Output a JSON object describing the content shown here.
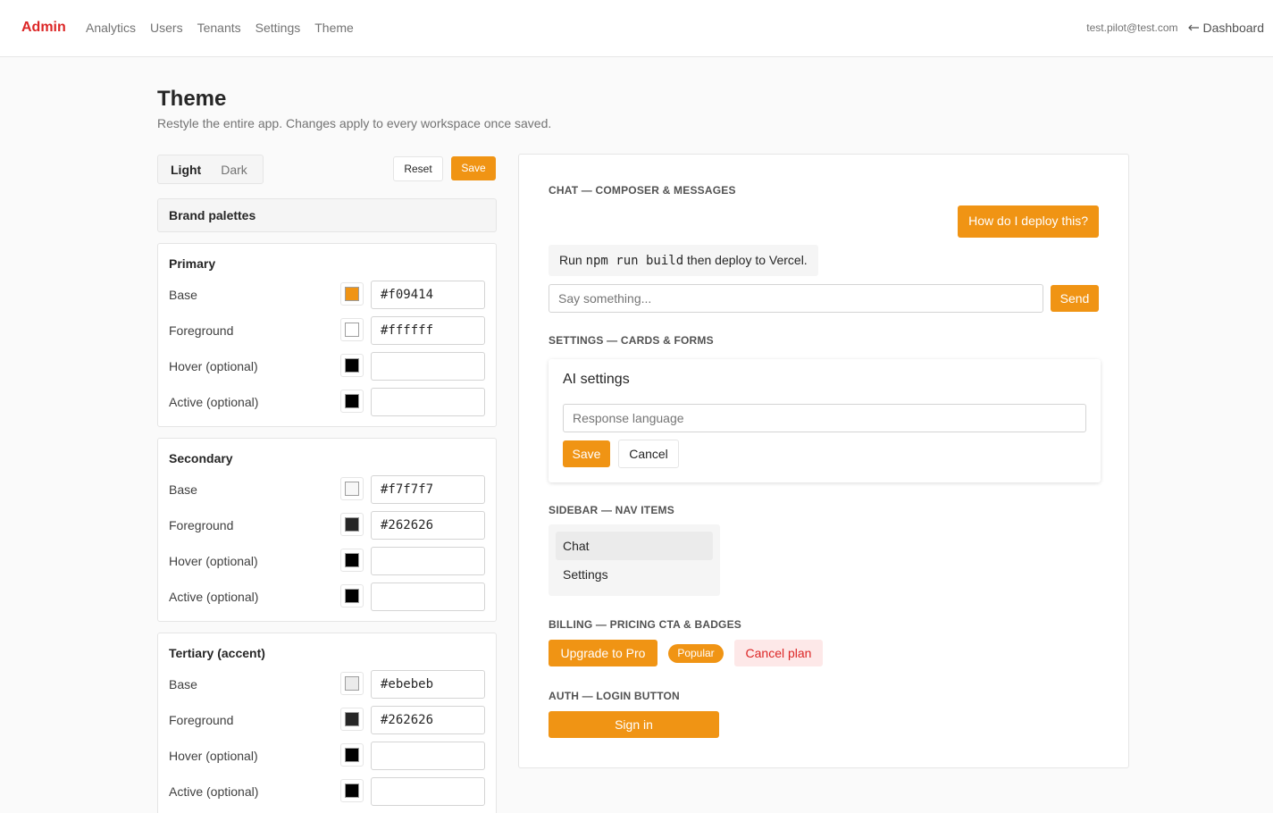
{
  "nav": {
    "brand": "Admin",
    "links": [
      "Analytics",
      "Users",
      "Tenants",
      "Settings",
      "Theme"
    ],
    "user_email": "test.pilot@test.com",
    "back_label": "Dashboard",
    "back_icon": "arrow-left-icon"
  },
  "header": {
    "title": "Theme",
    "subtitle": "Restyle the entire app. Changes apply to every workspace once saved."
  },
  "controls": {
    "mode_light": "Light",
    "mode_dark": "Dark",
    "active_mode": "Light",
    "reset_label": "Reset",
    "save_label": "Save"
  },
  "brand_palettes_label": "Brand palettes",
  "palettes": [
    {
      "title": "Primary",
      "rows": [
        {
          "label": "Base",
          "value": "#f09414",
          "swatch": "#f09414"
        },
        {
          "label": "Foreground",
          "value": "#ffffff",
          "swatch": "#ffffff"
        },
        {
          "label": "Hover (optional)",
          "value": "",
          "swatch": "#000000"
        },
        {
          "label": "Active (optional)",
          "value": "",
          "swatch": "#000000"
        }
      ]
    },
    {
      "title": "Secondary",
      "rows": [
        {
          "label": "Base",
          "value": "#f7f7f7",
          "swatch": "#f7f7f7"
        },
        {
          "label": "Foreground",
          "value": "#262626",
          "swatch": "#262626"
        },
        {
          "label": "Hover (optional)",
          "value": "",
          "swatch": "#000000"
        },
        {
          "label": "Active (optional)",
          "value": "",
          "swatch": "#000000"
        }
      ]
    },
    {
      "title": "Tertiary (accent)",
      "rows": [
        {
          "label": "Base",
          "value": "#ebebeb",
          "swatch": "#ebebeb"
        },
        {
          "label": "Foreground",
          "value": "#262626",
          "swatch": "#262626"
        },
        {
          "label": "Hover (optional)",
          "value": "",
          "swatch": "#000000"
        },
        {
          "label": "Active (optional)",
          "value": "",
          "swatch": "#000000"
        }
      ]
    }
  ],
  "preview": {
    "chat": {
      "heading": "CHAT — COMPOSER & MESSAGES",
      "user_message": "How do I deploy this?",
      "ai_message_prefix": "Run ",
      "ai_message_code": "npm run build",
      "ai_message_suffix": " then deploy to Vercel.",
      "input_placeholder": "Say something...",
      "send_label": "Send"
    },
    "settings": {
      "heading": "SETTINGS — CARDS & FORMS",
      "card_title": "AI settings",
      "input_placeholder": "Response language",
      "save_label": "Save",
      "cancel_label": "Cancel"
    },
    "sidebar": {
      "heading": "SIDEBAR — NAV ITEMS",
      "items": [
        "Chat",
        "Settings"
      ]
    },
    "billing": {
      "heading": "BILLING — PRICING CTA & BADGES",
      "upgrade_label": "Upgrade to Pro",
      "badge_label": "Popular",
      "cancel_label": "Cancel plan"
    },
    "auth": {
      "heading": "AUTH — LOGIN BUTTON",
      "signin_label": "Sign in"
    }
  },
  "colors": {
    "accent": "#f09414",
    "brand_red": "#dc2626",
    "text": "#262626",
    "muted": "#737373"
  }
}
